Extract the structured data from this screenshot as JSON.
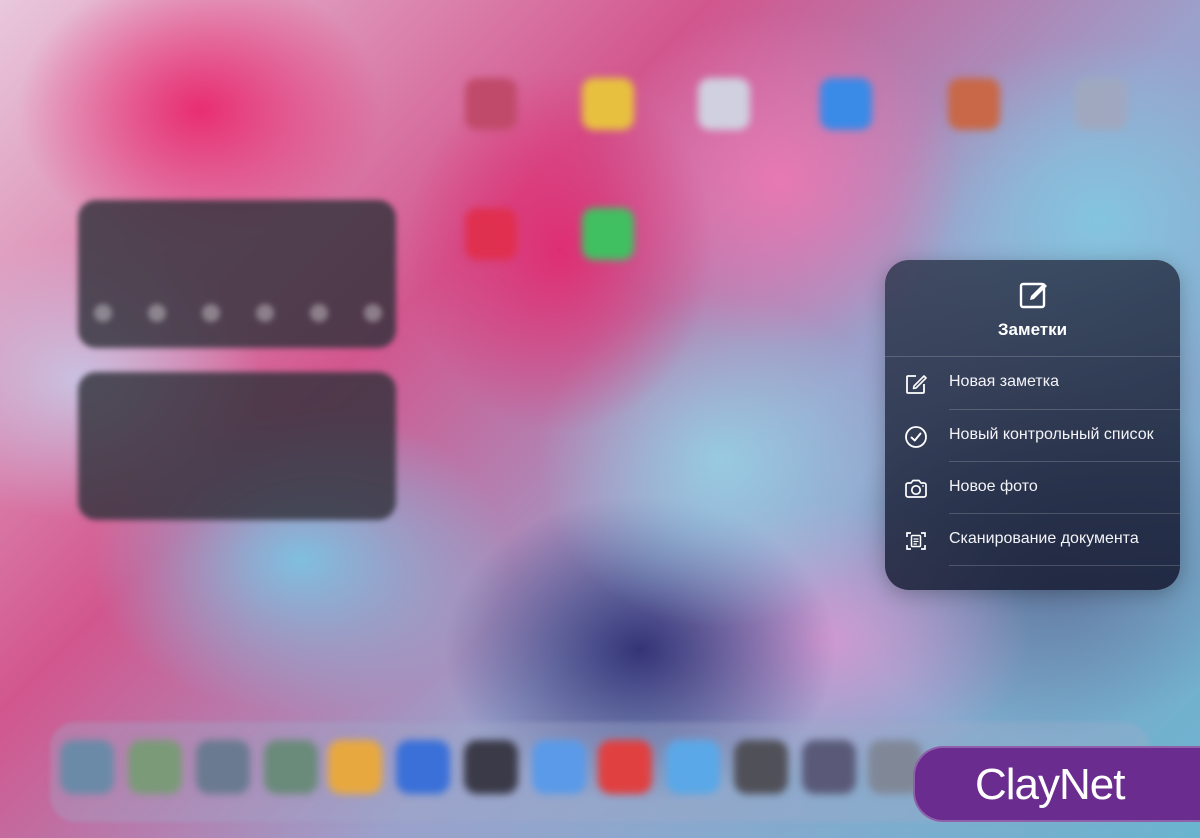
{
  "quick_actions": {
    "app_name": "Заметки",
    "app_icon": "compose-icon",
    "items": [
      {
        "label": "Новая заметка",
        "icon": "new-note-icon"
      },
      {
        "label": "Новый контрольный список",
        "icon": "checkmark-circle-icon"
      },
      {
        "label": "Новое фото",
        "icon": "camera-icon"
      },
      {
        "label": "Сканирование документа",
        "icon": "scan-document-icon"
      }
    ]
  },
  "watermark": {
    "text": "ClayNet",
    "color": "#6a2c8f"
  }
}
